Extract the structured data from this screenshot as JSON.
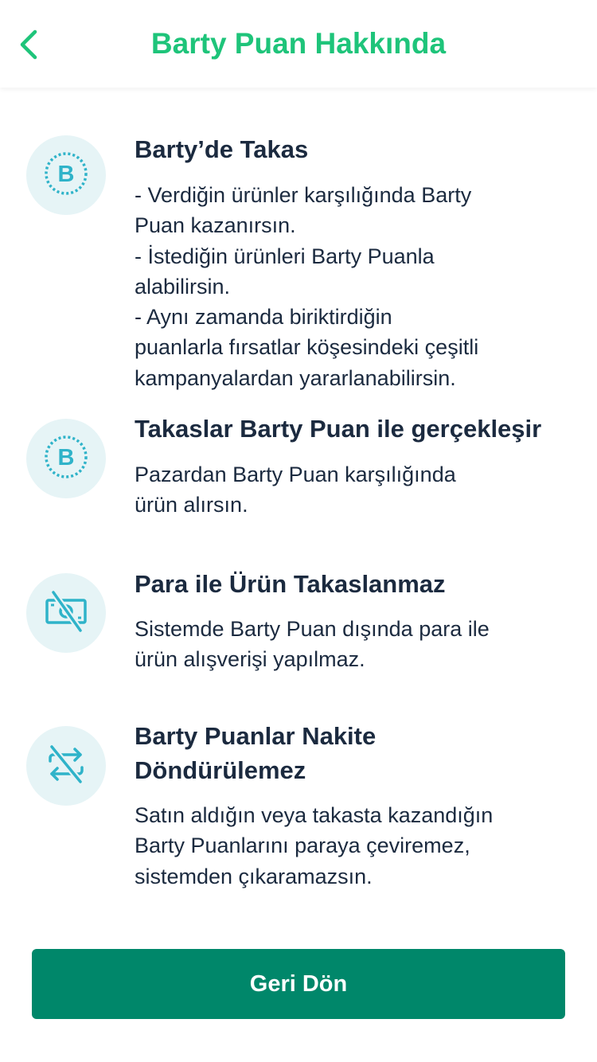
{
  "header": {
    "title": "Barty Puan Hakkında",
    "back_icon": "chevron-left-icon",
    "accent_color": "#1ec47a"
  },
  "sections": [
    {
      "icon": "barty-coin-icon",
      "title": "Barty’de Takas",
      "lines": [
        "- Verdiğin ürünler karşılığında Barty",
        "Puan kazanırsın.",
        "- İstediğin ürünleri Barty Puanla",
        "alabilirsin.",
        "- Aynı zamanda biriktirdiğin",
        "puanlarla fırsatlar köşesindeki çeşitli",
        "kampanyalardan yararlanabilirsin."
      ]
    },
    {
      "icon": "barty-coin-icon",
      "title": "Takaslar Barty Puan ile gerçekleşir",
      "lines": [
        "Pazardan Barty Puan karşılığında",
        "ürün alırsın."
      ]
    },
    {
      "icon": "no-money-icon",
      "title": "Para ile Ürün Takaslanmaz",
      "lines": [
        "Sistemde Barty Puan dışında para ile",
        "ürün alışverişi yapılmaz."
      ]
    },
    {
      "icon": "no-exchange-icon",
      "title_lines": [
        "Barty Puanlar Nakite",
        "Döndürülemez"
      ],
      "lines": [
        "Satın aldığın veya takasta kazandığın",
        "Barty Puanlarını paraya çeviremez,",
        "sistemden çıkaramazsın."
      ]
    }
  ],
  "footer": {
    "button_label": "Geri Dön",
    "button_color": "#00876a"
  },
  "colors": {
    "icon_bg": "#e6f4f6",
    "icon_fg": "#2fb3c9",
    "text": "#1b2a3f"
  }
}
